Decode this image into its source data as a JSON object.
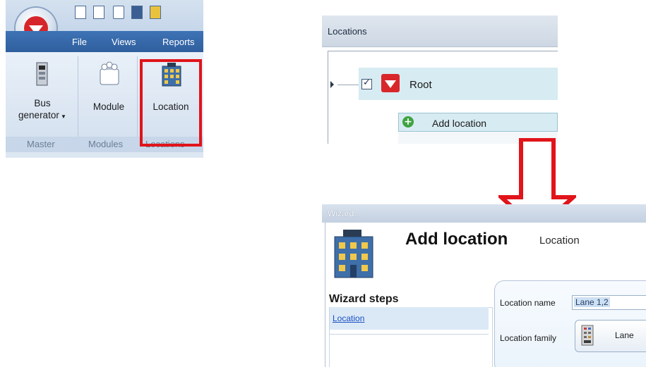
{
  "ribbon": {
    "menu": [
      "File",
      "Views",
      "Reports"
    ],
    "buttons": [
      {
        "label_line1": "Bus",
        "label_line2": "generator",
        "has_dropdown": true,
        "icon": "bus-generator-icon"
      },
      {
        "label": "Module",
        "icon": "module-icon"
      },
      {
        "label": "Location",
        "icon": "building-icon",
        "highlighted": true
      }
    ],
    "groups": [
      "Master",
      "Modules",
      "Locations"
    ],
    "highlight_color": "#e0141a"
  },
  "locations_panel": {
    "title": "Locations",
    "root_label": "Root",
    "root_checked": true,
    "add_item_label": "Add location"
  },
  "wizard": {
    "title": "Wizard...",
    "heading": "Add location",
    "subheading": "Location",
    "steps_title": "Wizard steps",
    "steps": [
      "Location"
    ],
    "fields": {
      "name_label": "Location name",
      "name_value": "Lane 1,2",
      "family_label": "Location family",
      "family_value": "Lane"
    }
  },
  "colors": {
    "brand_red": "#d6252a",
    "arrow": "#e0141a",
    "selection": "#d7ebf2"
  }
}
